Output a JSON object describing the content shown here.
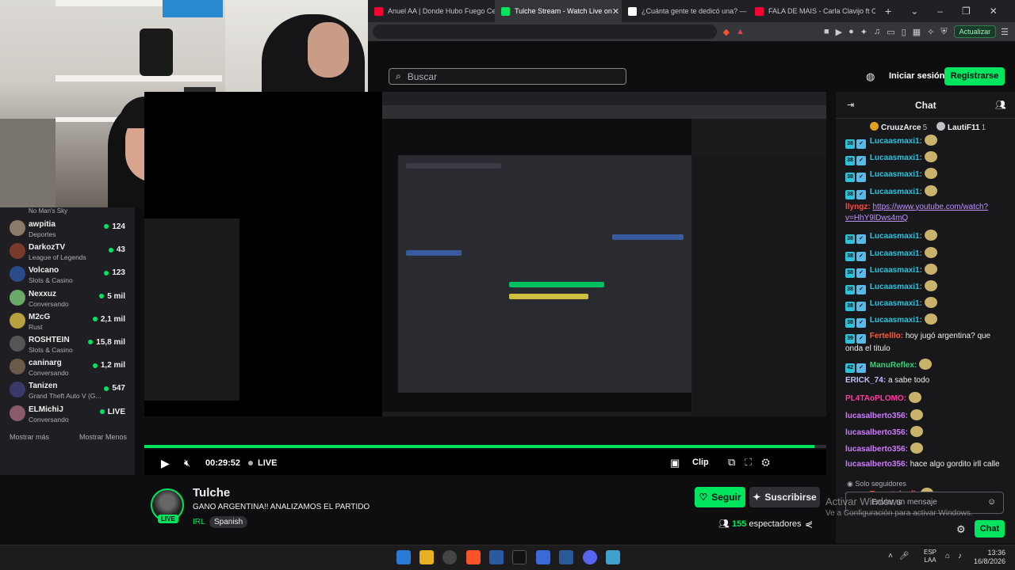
{
  "browser": {
    "tabs": [
      {
        "label": "Anuel AA | Donde Hubo Fuego Cen",
        "color": "#ff0033"
      },
      {
        "label": "Tulche Stream - Watch Live on",
        "color": "#00e55e",
        "active": true
      },
      {
        "label": "¿Cuánta gente te dedicó una? — de",
        "color": "#ffffff"
      },
      {
        "label": "FALA DE MAIS - Carla Clavijo ft Car",
        "color": "#ff0033"
      }
    ],
    "new_tab": "+",
    "update_button": "Actualizar"
  },
  "header": {
    "search_placeholder": "Buscar",
    "login": "Iniciar sesión",
    "register": "Registrarse"
  },
  "sidebar": {
    "top_category": "No Man's Sky",
    "channels": [
      {
        "name": "awpitia",
        "category": "Deportes",
        "viewers": "124",
        "color": "#8a7a6a"
      },
      {
        "name": "DarkozTV",
        "category": "League of Legends",
        "viewers": "43",
        "color": "#7a3a2a"
      },
      {
        "name": "Volcano",
        "category": "Slots & Casino",
        "viewers": "123",
        "color": "#2a4a8a"
      },
      {
        "name": "Nexxuz",
        "category": "Conversando",
        "viewers": "5 mil",
        "color": "#6aa86a"
      },
      {
        "name": "M2cG",
        "category": "Rust",
        "viewers": "2,1 mil",
        "color": "#b8a040"
      },
      {
        "name": "ROSHTEIN",
        "category": "Slots & Casino",
        "viewers": "15,8 mil",
        "color": "#555"
      },
      {
        "name": "caninarg",
        "category": "Conversando",
        "viewers": "1,2 mil",
        "color": "#6a5a4a"
      },
      {
        "name": "Tanizen",
        "category": "Grand Theft Auto V (G...",
        "viewers": "547",
        "color": "#3a3a6a"
      },
      {
        "name": "ELMichiJ",
        "category": "Conversando",
        "viewers": "LIVE",
        "color": "#8a5a6a"
      }
    ],
    "show_more": "Mostrar más",
    "show_less": "Mostrar Menos"
  },
  "player": {
    "time": "00:29:52",
    "live": "LIVE",
    "clip": "Clip"
  },
  "stream": {
    "streamer": "Tulche",
    "live_badge": "LIVE",
    "title": "GANO ARGENTINA!! ANALIZAMOS EL PARTIDO",
    "category": "IRL",
    "language": "Spanish",
    "follow": "Seguir",
    "subscribe": "Suscribirse",
    "viewers_count": "155",
    "viewers_label": "espectadores"
  },
  "chat": {
    "title": "Chat",
    "leaderboard": [
      {
        "name": "CruuzArce",
        "count": "5",
        "color": "#e0a020"
      },
      {
        "name": "LautiF11",
        "count": "1",
        "color": "#c0c0c8"
      }
    ],
    "messages": [
      {
        "badge": "38",
        "user": "Lucaasmaxi1",
        "color": "#2dc2d9",
        "text": "",
        "emote": true
      },
      {
        "badge": "38",
        "user": "Lucaasmaxi1",
        "color": "#2dc2d9",
        "text": "",
        "emote": true
      },
      {
        "badge": "38",
        "user": "Lucaasmaxi1",
        "color": "#2dc2d9",
        "text": "",
        "emote": true
      },
      {
        "badge": "38",
        "user": "Lucaasmaxi1",
        "color": "#2dc2d9",
        "text": "",
        "emote": true
      },
      {
        "badge": "",
        "user": "llyngz",
        "color": "#ff4a4a",
        "text": "",
        "link": "https://www.youtube.com/watch?v=HhY9lDws4mQ"
      },
      {
        "badge": "38",
        "user": "Lucaasmaxi1",
        "color": "#2dc2d9",
        "text": "",
        "emote": true
      },
      {
        "badge": "38",
        "user": "Lucaasmaxi1",
        "color": "#2dc2d9",
        "text": "",
        "emote": true
      },
      {
        "badge": "38",
        "user": "Lucaasmaxi1",
        "color": "#2dc2d9",
        "text": "",
        "emote": true
      },
      {
        "badge": "38",
        "user": "Lucaasmaxi1",
        "color": "#2dc2d9",
        "text": "",
        "emote": true
      },
      {
        "badge": "38",
        "user": "Lucaasmaxi1",
        "color": "#2dc2d9",
        "text": "",
        "emote": true
      },
      {
        "badge": "38",
        "user": "Lucaasmaxi1",
        "color": "#2dc2d9",
        "text": "",
        "emote": true
      },
      {
        "badge": "39",
        "user": "Fertelllo",
        "color": "#ff5a3a",
        "text": "hoy jugó argentina? que onda el titulo"
      },
      {
        "badge": "42",
        "user": "ManuReflex",
        "color": "#3ad17a",
        "text": "",
        "emote": true
      },
      {
        "badge": "",
        "user": "ERICK_74",
        "color": "#c0c0ff",
        "text": "a sabe todo"
      },
      {
        "badge": "",
        "user": "PL4TAoPLOMO",
        "color": "#ff3aa0",
        "text": "",
        "emote": true
      },
      {
        "badge": "",
        "user": "lucasalberto356",
        "color": "#d07aff",
        "text": "",
        "emote": true
      },
      {
        "badge": "",
        "user": "lucasalberto356",
        "color": "#d07aff",
        "text": "",
        "emote": true
      },
      {
        "badge": "",
        "user": "lucasalberto356",
        "color": "#d07aff",
        "text": "",
        "emote": true
      },
      {
        "badge": "",
        "user": "lucasalberto356",
        "color": "#d07aff",
        "text": "hace algo gordito irll calle"
      },
      {
        "badge": "34",
        "user": "Ernestoh_dl",
        "color": "#ff4040",
        "text": "",
        "emote": true
      }
    ],
    "followers_only": "Solo seguidores",
    "input_placeholder": "Enviar un mensaje",
    "send": "Chat"
  },
  "overlay": {
    "activate_windows": "Activar Windows",
    "activate_windows_sub": "Ve a Configuración para activar Windows."
  },
  "taskbar": {
    "lang_line1": "ESP",
    "lang_line2": "LAA",
    "time": "13:36",
    "date": "16/8/2026"
  },
  "icons": {
    "search": "search-icon",
    "globe": "globe-icon",
    "play": "play-icon",
    "settings": "gear-icon",
    "share": "share-icon",
    "users": "users-icon"
  },
  "colors": {
    "accent": "#00e55e",
    "bg": "#0e0e10",
    "chat_bg": "#18181b"
  }
}
